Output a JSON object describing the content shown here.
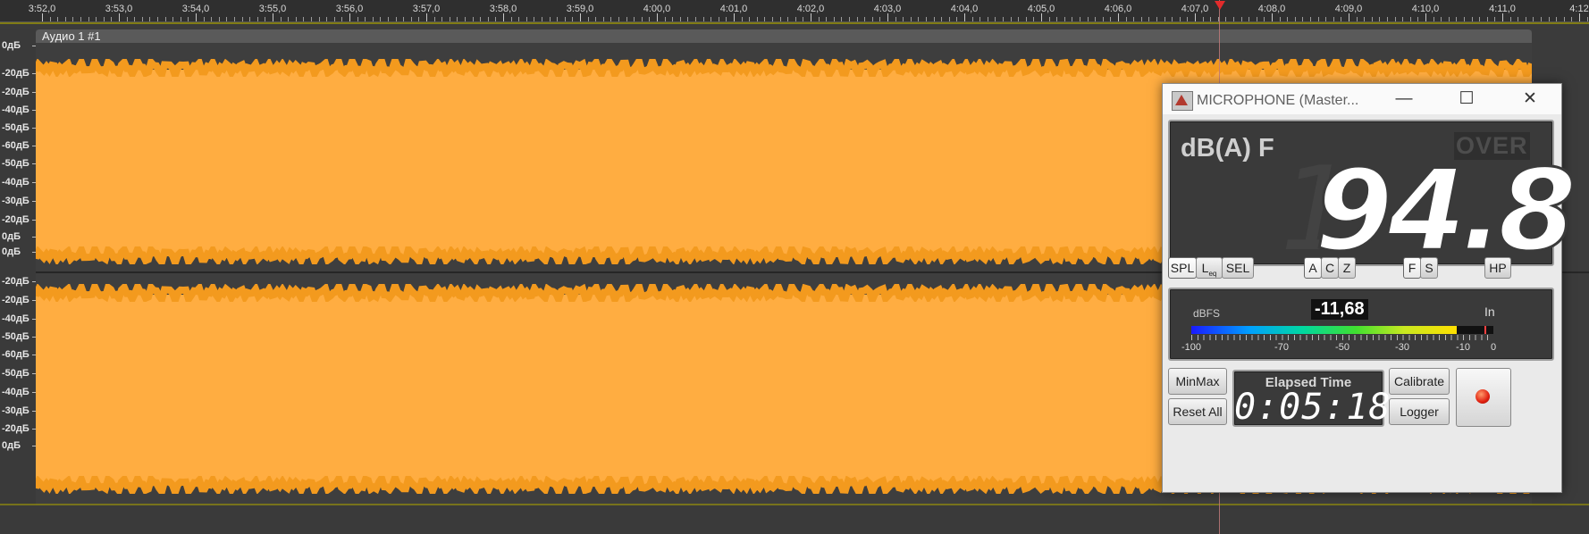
{
  "ruler": {
    "labels": [
      "3:52,0",
      "3:53,0",
      "3:54,0",
      "3:55,0",
      "3:56,0",
      "3:57,0",
      "3:58,0",
      "3:59,0",
      "4:00,0",
      "4:01,0",
      "4:02,0",
      "4:03,0",
      "4:04,0",
      "4:05,0",
      "4:06,0",
      "4:07,0",
      "4:08,0",
      "4:09,0",
      "4:10,0",
      "4:11,0",
      "4:12"
    ]
  },
  "track": {
    "clip_title": "Аудио 1 #1",
    "db_labels_top": [
      "0дБ",
      "-20дБ",
      "-20дБ",
      "-40дБ",
      "-50дБ",
      "-60дБ",
      "-50дБ",
      "-40дБ",
      "-30дБ",
      "-20дБ",
      "0дБ"
    ],
    "db_labels_bottom": [
      "0дБ",
      "-20дБ",
      "-20дБ",
      "-40дБ",
      "-50дБ",
      "-60дБ",
      "-50дБ",
      "-40дБ",
      "-30дБ",
      "-20дБ",
      "0дБ"
    ]
  },
  "meter": {
    "title": "MICROPHONE (Master...",
    "minimize_glyph": "—",
    "maximize_glyph": "☐",
    "close_glyph": "✕",
    "weighting_label": "dB(A) F",
    "over_label": "OVER",
    "ghost_digit": "1",
    "value": "94.8",
    "buttons": {
      "spl": "SPL",
      "leq_main": "L",
      "leq_sub": "eq",
      "sel": "SEL",
      "a": "A",
      "c": "C",
      "z": "Z",
      "f": "F",
      "s": "S",
      "hp": "HP",
      "minmax": "MinMax",
      "reset_all": "Reset All",
      "calibrate": "Calibrate",
      "logger": "Logger"
    },
    "level": {
      "unit_label": "dBFS",
      "value": "-11,68",
      "input_label": "In",
      "fill_fraction": 0.88,
      "scale": [
        "-100",
        "-70",
        "-50",
        "-30",
        "-10",
        "0"
      ]
    },
    "elapsed": {
      "label": "Elapsed Time",
      "value": "0:05:18"
    },
    "colors": {
      "waveform": "#ffad41",
      "waveform_edge": "#f39a1e",
      "playhead": "#e22b2b",
      "record": "#e01f0f"
    }
  }
}
